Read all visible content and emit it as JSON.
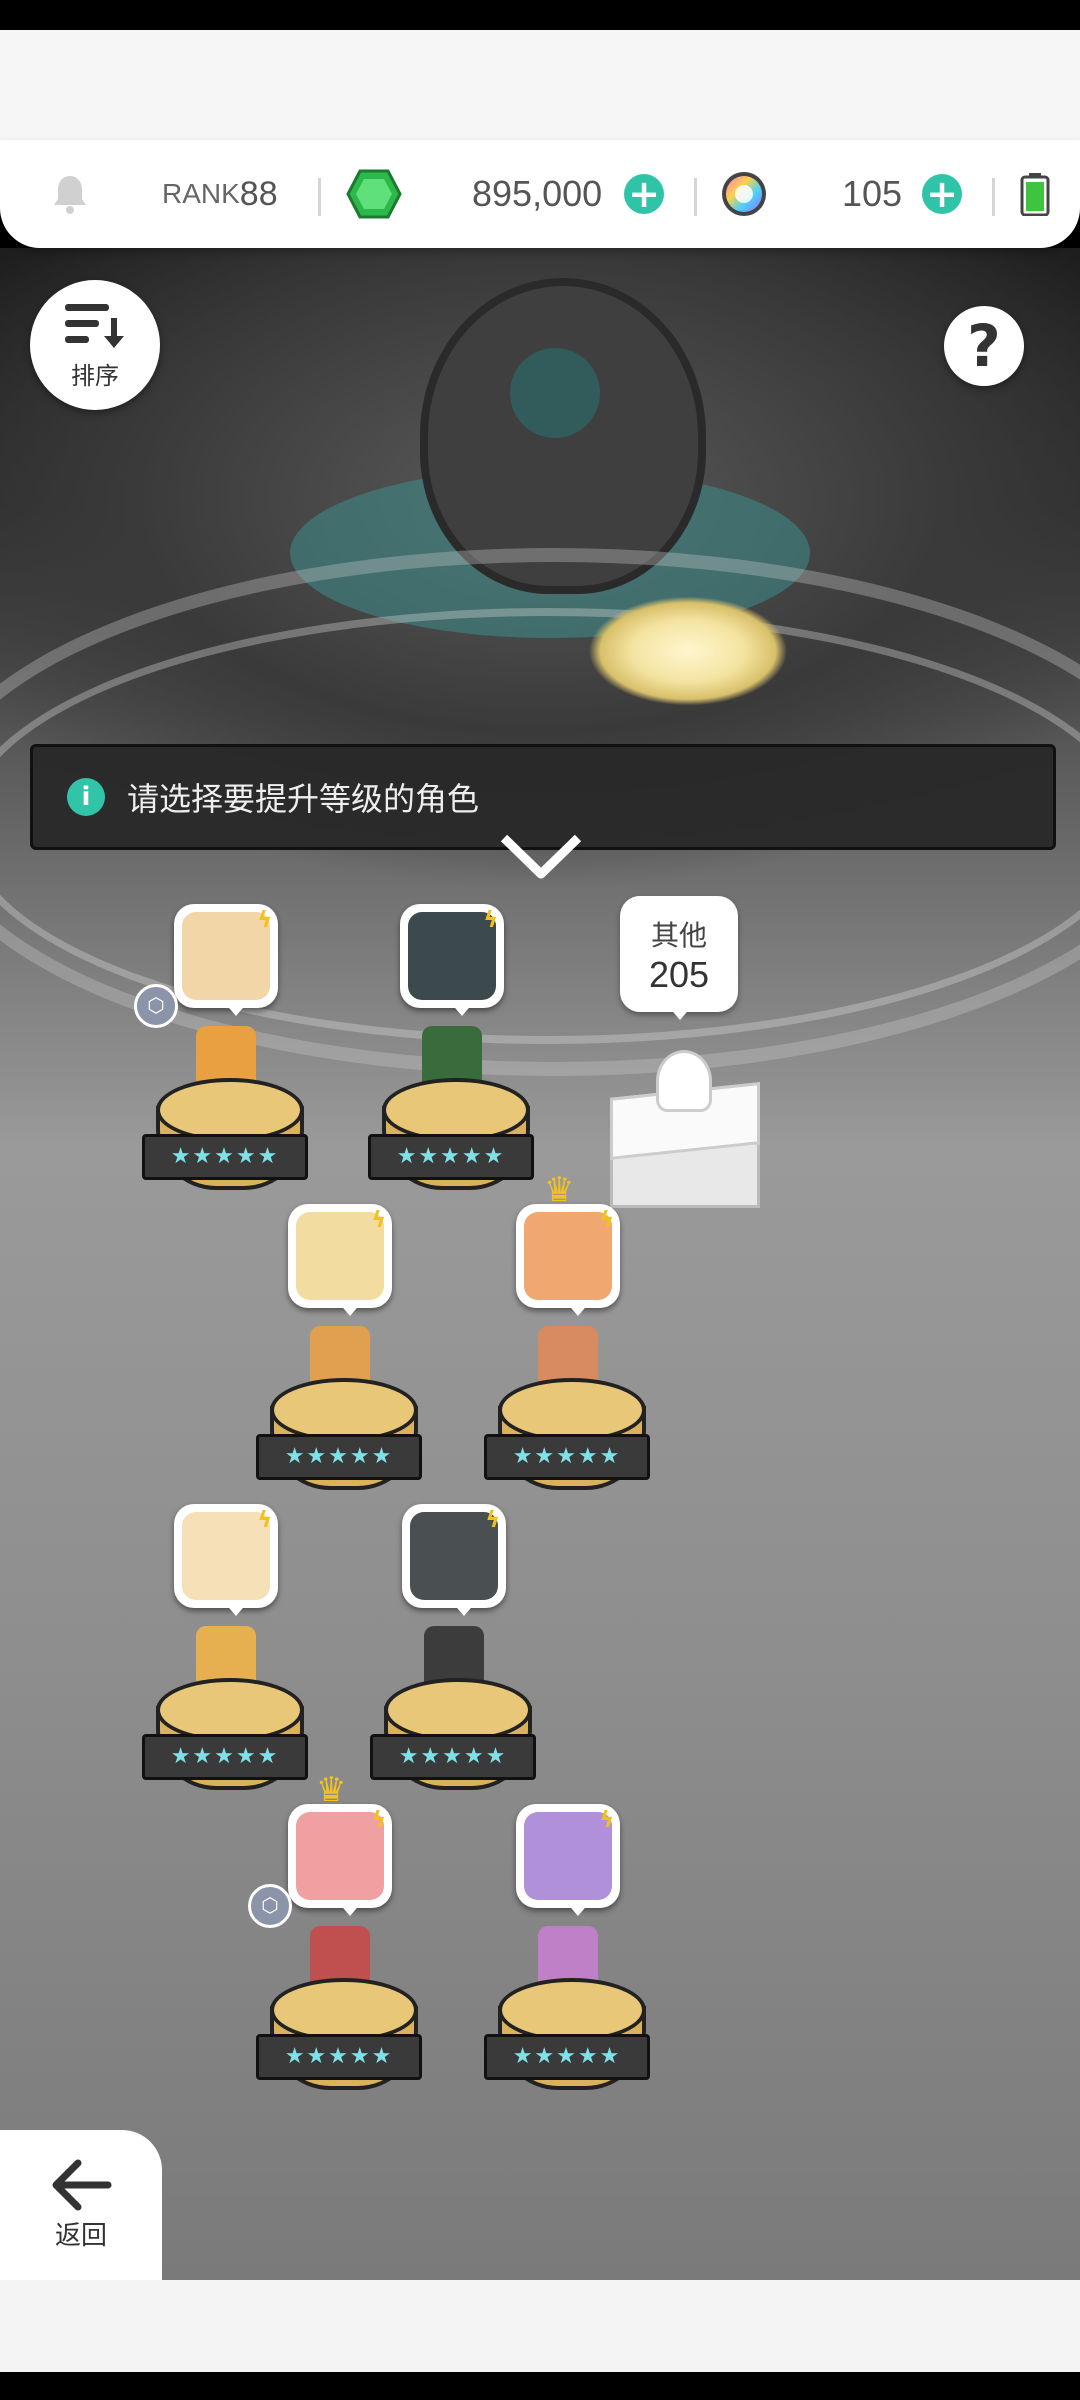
{
  "header": {
    "rank_prefix": "RANK",
    "rank_value": "88",
    "gems": "895,000",
    "orbs": "105"
  },
  "toolbar": {
    "sort_label": "排序",
    "help_glyph": "?"
  },
  "banner": {
    "message": "请选择要提升等级的角色"
  },
  "other": {
    "label": "其他",
    "count": "205"
  },
  "characters": [
    {
      "stars": "★★★★★",
      "face_color": "#f3d6a8",
      "sprite_color": "#e8a040",
      "crown": false,
      "badge": true
    },
    {
      "stars": "★★★★★",
      "face_color": "#3c4a4e",
      "sprite_color": "#3a6b3c",
      "crown": false,
      "badge": false
    },
    {
      "stars": "★★★★★",
      "face_color": "#f2dca0",
      "sprite_color": "#e0a050",
      "crown": false,
      "badge": false
    },
    {
      "stars": "★★★★★",
      "face_color": "#f0a870",
      "sprite_color": "#d88a60",
      "crown": true,
      "badge": false
    },
    {
      "stars": "★★★★★",
      "face_color": "#f6e0b8",
      "sprite_color": "#e6b050",
      "crown": false,
      "badge": false
    },
    {
      "stars": "★★★★★",
      "face_color": "#4a4f52",
      "sprite_color": "#3c3c3c",
      "crown": false,
      "badge": false
    },
    {
      "stars": "★★★★★",
      "face_color": "#f0a0a0",
      "sprite_color": "#c05050",
      "crown": true,
      "badge": true
    },
    {
      "stars": "★★★★★",
      "face_color": "#b090d8",
      "sprite_color": "#c080c8",
      "crown": false,
      "badge": false
    }
  ],
  "nav": {
    "back_label": "返回"
  },
  "colors": {
    "accent": "#2fc4a8",
    "gem": "#2db84a",
    "star": "#7fe0e8",
    "pedestal": "#d9b25b"
  },
  "icons": [
    "bell-icon",
    "gem-icon",
    "rainbow-orb-icon",
    "plus-icon",
    "battery-icon",
    "sort-icon",
    "help-icon",
    "info-icon",
    "chevron-down-icon",
    "lightning-icon",
    "crown-icon",
    "back-arrow-icon"
  ]
}
